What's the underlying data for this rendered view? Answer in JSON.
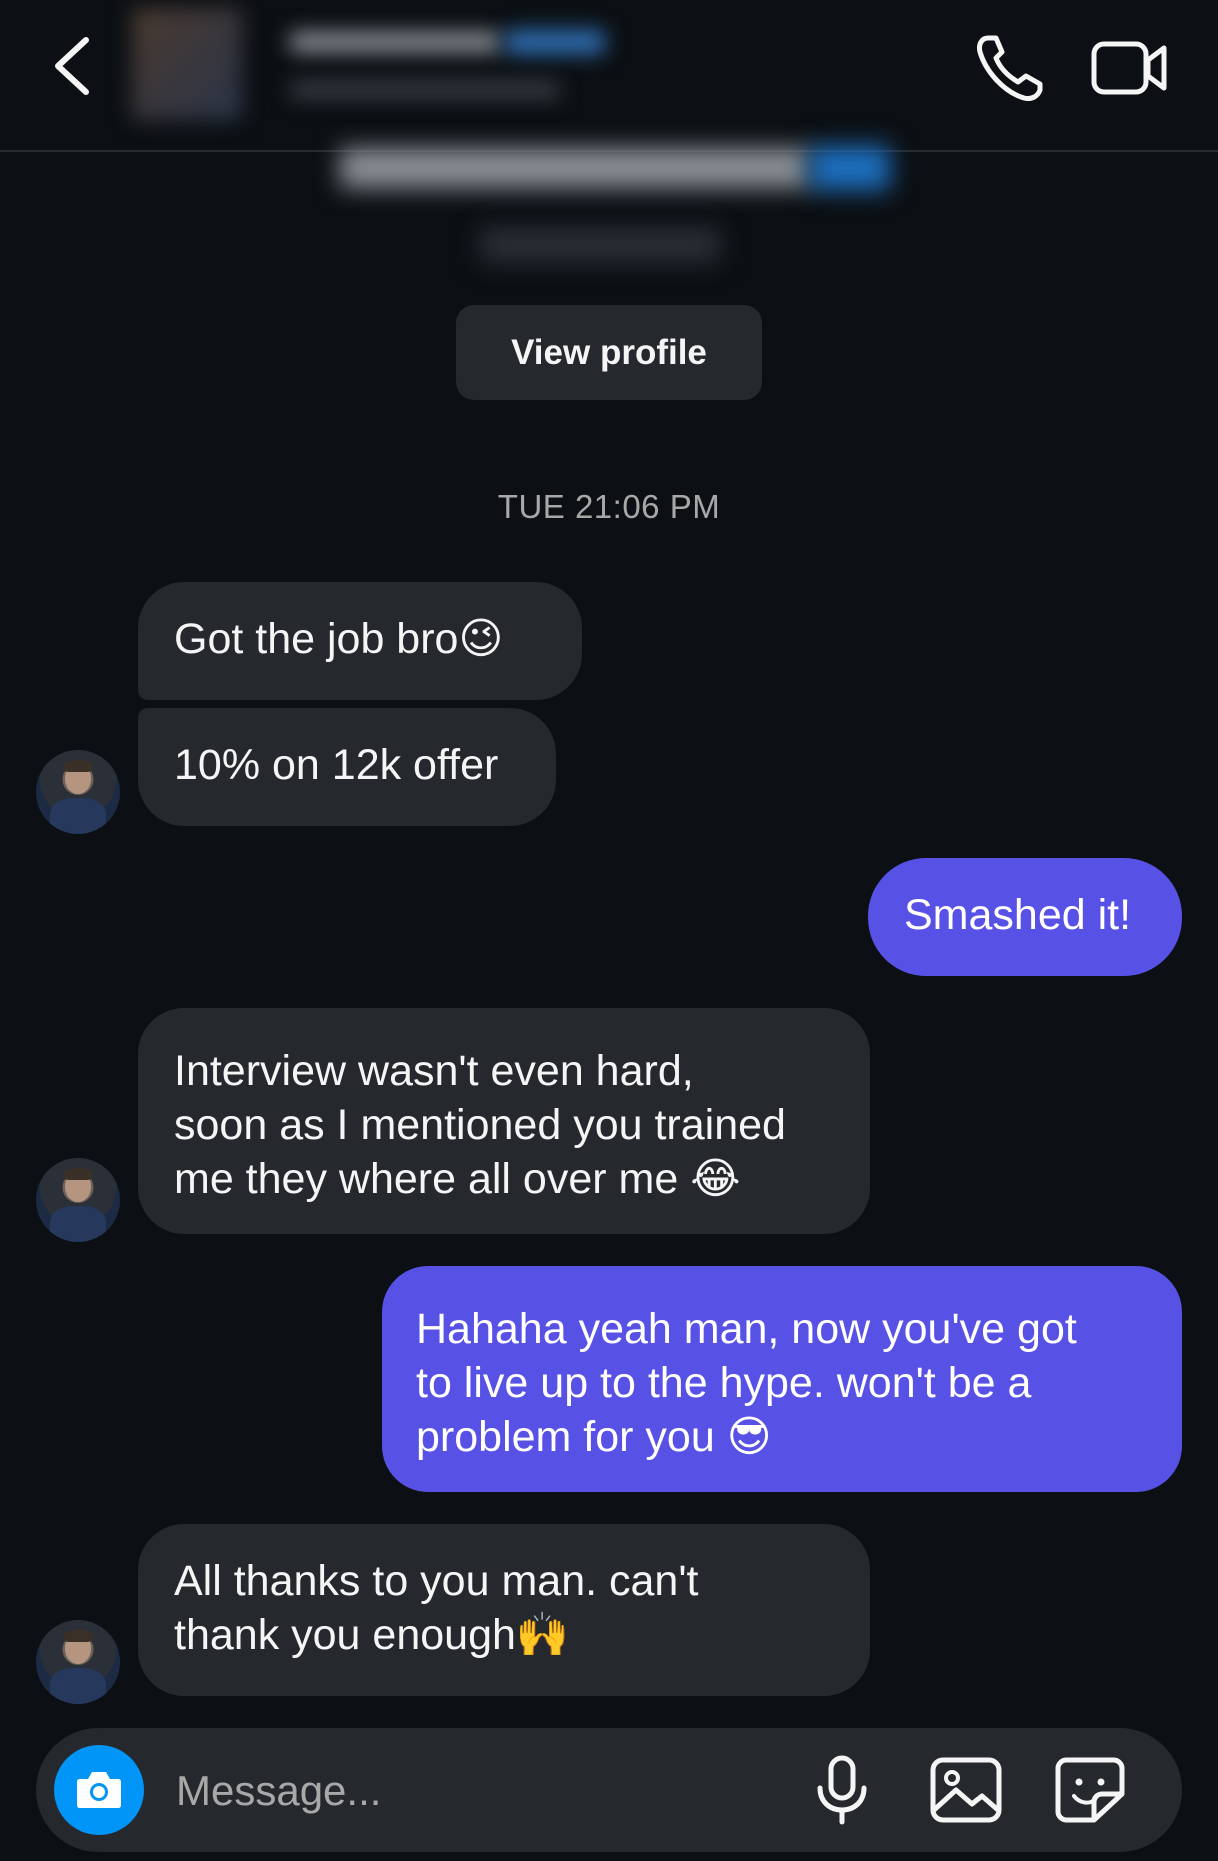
{
  "header": {
    "back_icon": "chevron-left-icon",
    "call_icon": "phone-icon",
    "video_icon": "video-camera-icon"
  },
  "profile": {
    "view_profile_label": "View profile"
  },
  "conversation": {
    "timestamp": "TUE 21:06 PM",
    "messages": [
      {
        "direction": "incoming",
        "text": "Got the job bro",
        "emoji": "😉"
      },
      {
        "direction": "incoming",
        "text": "10% on 12k offer"
      },
      {
        "direction": "outgoing",
        "text": "Smashed it!"
      },
      {
        "direction": "incoming",
        "lines": [
          "Interview wasn't even hard,",
          "soon as I mentioned you trained",
          "me they where all over me "
        ],
        "emoji": "😂"
      },
      {
        "direction": "outgoing",
        "lines": [
          "Hahaha yeah man, now you've got",
          "to live up to the hype. won't be a",
          "problem for you "
        ],
        "emoji": "😎"
      },
      {
        "direction": "incoming",
        "lines": [
          "All thanks to you man. can't",
          "thank you enough"
        ],
        "emoji": "🙌"
      }
    ]
  },
  "composer": {
    "placeholder": "Message...",
    "camera_icon": "camera-icon",
    "mic_icon": "microphone-icon",
    "gallery_icon": "gallery-icon",
    "sticker_icon": "sticker-icon"
  },
  "colors": {
    "background": "#0c1014",
    "incoming_bubble": "#25292e",
    "outgoing_bubble": "#5851e6",
    "accent_blue": "#0095f6"
  }
}
